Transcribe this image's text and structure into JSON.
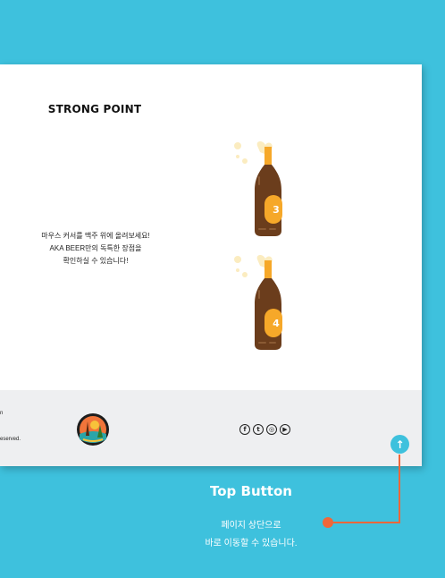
{
  "section": {
    "title": "STRONG POINT",
    "description": [
      "마우스 커서를 맥주 위에 올려보세요!",
      "AKA BEER만의 독특한 장점을",
      "확인하실 수 있습니다!"
    ]
  },
  "bottles": [
    {
      "number": "3"
    },
    {
      "number": "4"
    }
  ],
  "footer": {
    "line1": "n",
    "line2": "eserved.",
    "social_icons": [
      "facebook-icon",
      "twitter-icon",
      "instagram-icon",
      "youtube-icon"
    ],
    "social_glyphs": [
      "f",
      "t",
      "◎",
      "▶"
    ]
  },
  "top_button": {
    "glyph": "↑"
  },
  "callout": {
    "title": "Top Button",
    "lines": [
      "페이지 상단으로",
      "바로 이동할 수 있습니다."
    ]
  },
  "colors": {
    "background": "#3ec1dd",
    "bottle": "#6b3d1c",
    "foam": "#f6a829",
    "accent": "#f0673a"
  }
}
